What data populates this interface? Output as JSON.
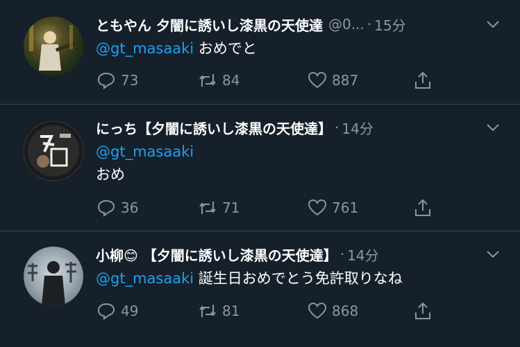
{
  "tweets": [
    {
      "name": "ともやん 夕闇に誘いし漆黒の天使達",
      "handle": "@0...",
      "time": "15分",
      "mention": "@gt_masaaki",
      "text": "おめでと",
      "replies": "73",
      "retweets": "84",
      "likes": "887"
    },
    {
      "name": "にっち【夕闇に誘いし漆黒の天使達】",
      "handle": "",
      "time": "14分",
      "mention": "@gt_masaaki",
      "text": "おめ",
      "replies": "36",
      "retweets": "71",
      "likes": "761"
    },
    {
      "name": "小柳😊 【夕闇に誘いし漆黒の天使達】",
      "handle": "",
      "time": "14分",
      "mention": "@gt_masaaki",
      "text": "誕生日おめでとう免許取りなね",
      "replies": "49",
      "retweets": "81",
      "likes": "868"
    }
  ],
  "colors": {
    "background": "#15202b",
    "mention": "#1da1f2",
    "muted": "#8899a6",
    "divider": "#38444d"
  }
}
